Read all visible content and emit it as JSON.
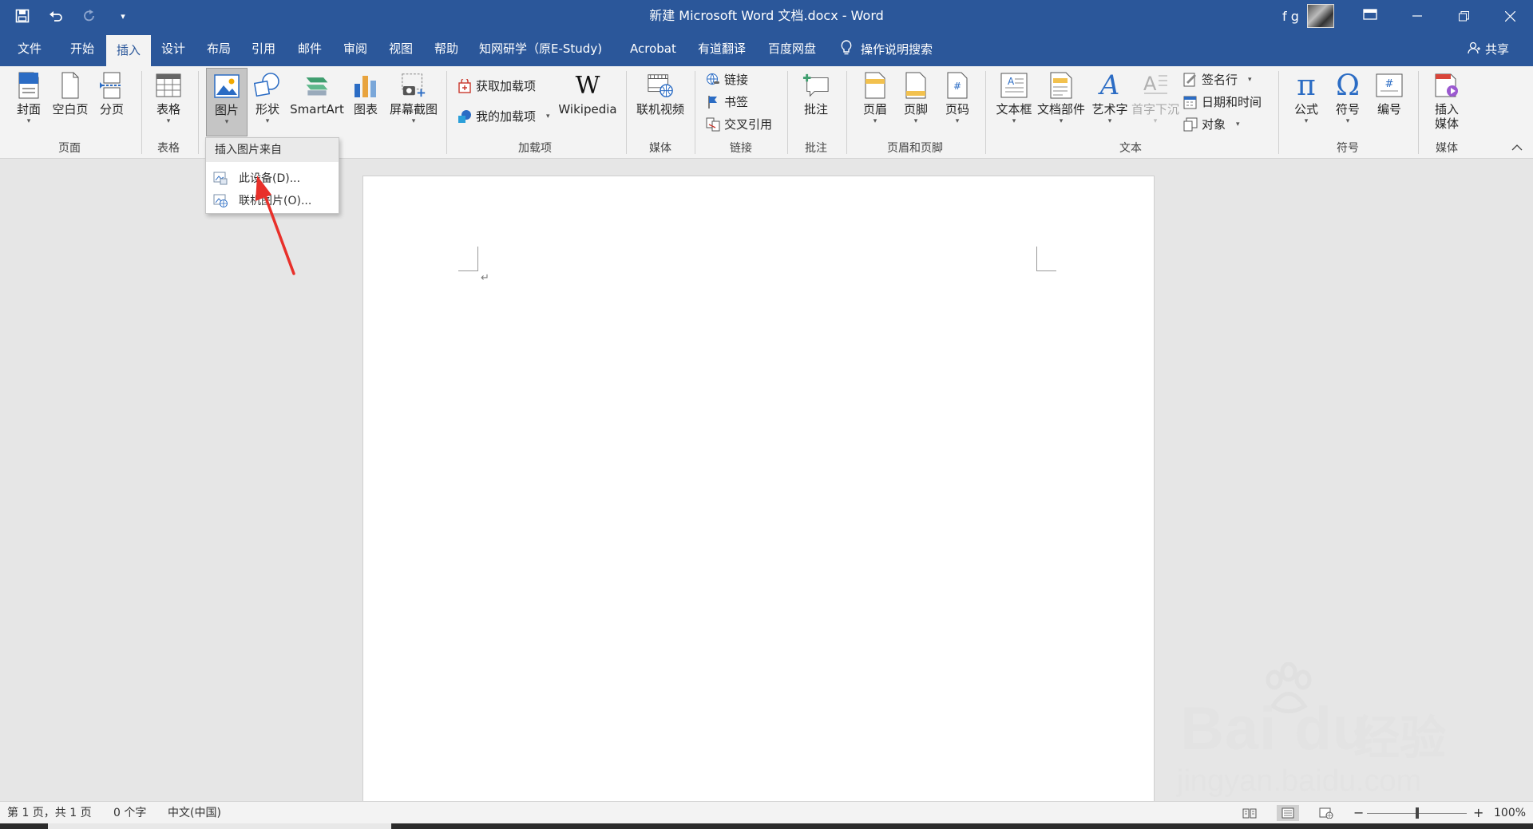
{
  "window": {
    "title": "新建 Microsoft Word 文档.docx  -  Word",
    "user_name": "f g",
    "minimize_icon": "minimize-icon",
    "restore_icon": "restore-icon",
    "close_icon": "close-icon"
  },
  "qat": {
    "save_icon": "save-icon",
    "undo_icon": "undo-icon",
    "redo_icon": "redo-icon",
    "customize_icon": "customize-qat-icon"
  },
  "tabs": {
    "file": "文件",
    "home": "开始",
    "insert": "插入",
    "design": "设计",
    "layout": "布局",
    "references": "引用",
    "mailings": "邮件",
    "review": "审阅",
    "view": "视图",
    "help": "帮助",
    "cnki": "知网研学（原E-Study)",
    "acrobat": "Acrobat",
    "youdao": "有道翻译",
    "baidu": "百度网盘",
    "tell_me": "操作说明搜索",
    "share": "共享"
  },
  "ribbon": {
    "cover": "封面",
    "blank_page": "空白页",
    "page_break": "分页",
    "table": "表格",
    "pictures": "图片",
    "shapes": "形状",
    "smartart": "SmartArt",
    "chart": "图表",
    "screenshot": "屏幕截图",
    "get_addins": "获取加载项",
    "my_addins": "我的加载项",
    "wikipedia": "Wikipedia",
    "online_video": "联机视频",
    "link": "链接",
    "bookmark": "书签",
    "cross_ref": "交叉引用",
    "comment": "批注",
    "header": "页眉",
    "footer": "页脚",
    "page_number": "页码",
    "text_box": "文本框",
    "quick_parts": "文档部件",
    "wordart": "艺术字",
    "drop_cap": "首字下沉",
    "signature_line": "签名行",
    "date_time": "日期和时间",
    "object": "对象",
    "equation": "公式",
    "symbol": "符号",
    "number": "编号",
    "insert_media": "插入\n媒体",
    "insert_media_l1": "插入",
    "insert_media_l2": "媒体"
  },
  "groups": {
    "pages": "页面",
    "tables": "表格",
    "addins": "加载项",
    "media": "媒体",
    "links": "链接",
    "comments": "批注",
    "header_footer": "页眉和页脚",
    "text": "文本",
    "symbols": "符号",
    "media2": "媒体"
  },
  "dropdown": {
    "header": "插入图片来自",
    "this_device": "此设备(D)...",
    "online_pictures": "联机图片(O)..."
  },
  "document": {
    "paragraph_mark": "↵"
  },
  "status": {
    "page": "第 1 页，共 1 页",
    "words": "0 个字",
    "language": "中文(中国)",
    "zoom": "100%",
    "zoom_minus": "−",
    "zoom_plus": "+",
    "zoom_level": 1.0
  },
  "watermark": {
    "logo": "Bai du",
    "cn": "经验",
    "url": "jingyan.baidu.com"
  },
  "colors": {
    "brand": "#2b579a",
    "ribbon_bg": "#f3f3f3",
    "workspace": "#e6e6e6",
    "annotation_arrow": "#e8302a"
  }
}
